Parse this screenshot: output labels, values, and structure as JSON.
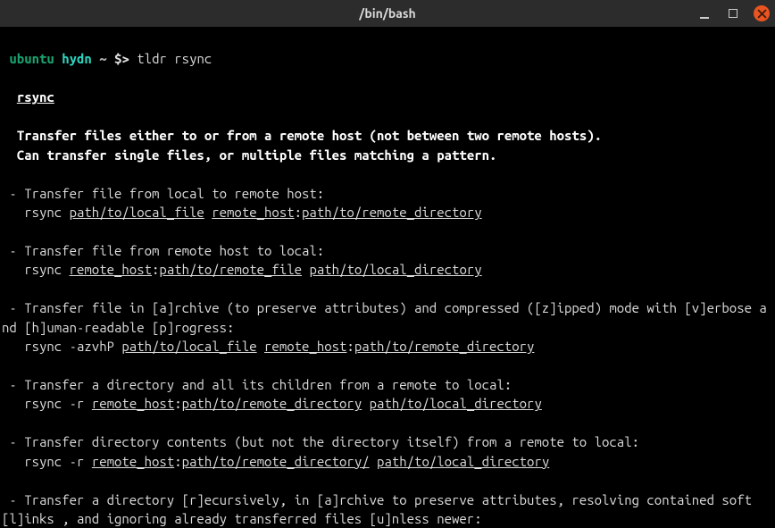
{
  "window": {
    "title": "/bin/bash"
  },
  "prompt": {
    "user": "ubuntu",
    "host": "hydn",
    "cwd": "~",
    "symbol": "$>",
    "command": "tldr rsync"
  },
  "tldr": {
    "name": "rsync",
    "description1": "Transfer files either to or from a remote host (not between two remote hosts).",
    "description2": "Can transfer single files, or multiple files matching a pattern.",
    "entries": [
      {
        "label": " - Transfer file from local to remote host:",
        "prefix": "   rsync ",
        "parts": [
          {
            "text": "path/to/local_file",
            "u": true
          },
          {
            "text": " ",
            "u": false
          },
          {
            "text": "remote_host",
            "u": true
          },
          {
            "text": ":",
            "u": false
          },
          {
            "text": "path/to/remote_directory",
            "u": true
          }
        ]
      },
      {
        "label": " - Transfer file from remote host to local:",
        "prefix": "   rsync ",
        "parts": [
          {
            "text": "remote_host",
            "u": true
          },
          {
            "text": ":",
            "u": false
          },
          {
            "text": "path/to/remote_file",
            "u": true
          },
          {
            "text": " ",
            "u": false
          },
          {
            "text": "path/to/local_directory",
            "u": true
          }
        ]
      },
      {
        "label": " - Transfer file in [a]rchive (to preserve attributes) and compressed ([z]ipped) mode with [v]erbose and [h]uman-readable [p]rogress:",
        "prefix": "   rsync -azvhP ",
        "parts": [
          {
            "text": "path/to/local_file",
            "u": true
          },
          {
            "text": " ",
            "u": false
          },
          {
            "text": "remote_host",
            "u": true
          },
          {
            "text": ":",
            "u": false
          },
          {
            "text": "path/to/remote_directory",
            "u": true
          }
        ]
      },
      {
        "label": " - Transfer a directory and all its children from a remote to local:",
        "prefix": "   rsync -r ",
        "parts": [
          {
            "text": "remote_host",
            "u": true
          },
          {
            "text": ":",
            "u": false
          },
          {
            "text": "path/to/remote_directory",
            "u": true
          },
          {
            "text": " ",
            "u": false
          },
          {
            "text": "path/to/local_directory",
            "u": true
          }
        ]
      },
      {
        "label": " - Transfer directory contents (but not the directory itself) from a remote to local:",
        "prefix": "   rsync -r ",
        "parts": [
          {
            "text": "remote_host",
            "u": true
          },
          {
            "text": ":",
            "u": false
          },
          {
            "text": "path/to/remote_directory/",
            "u": true
          },
          {
            "text": " ",
            "u": false
          },
          {
            "text": "path/to/local_directory",
            "u": true
          }
        ]
      },
      {
        "label": " - Transfer a directory [r]ecursively, in [a]rchive to preserve attributes, resolving contained soft[l]inks , and ignoring already transferred files [u]nless newer:",
        "prefix": "",
        "parts": []
      }
    ]
  }
}
